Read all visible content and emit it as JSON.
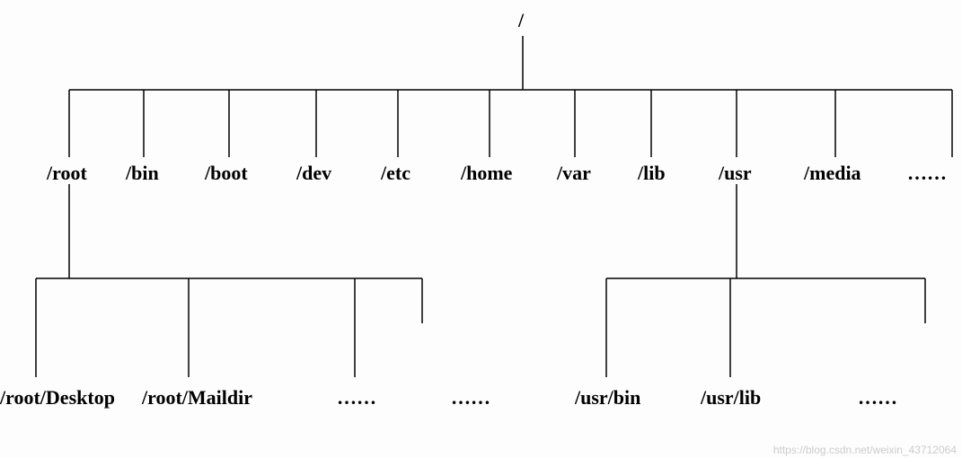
{
  "root": "/",
  "level1": {
    "root": "/root",
    "bin": "/bin",
    "boot": "/boot",
    "dev": "/dev",
    "etc": "/etc",
    "home": "/home",
    "var": "/var",
    "lib": "/lib",
    "usr": "/usr",
    "media": "/media",
    "more": "……"
  },
  "level2_root": {
    "desktop": "/root/Desktop",
    "maildir": "/root/Maildir",
    "more1": "……",
    "more2": "……"
  },
  "level2_usr": {
    "bin": "/usr/bin",
    "lib": "/usr/lib",
    "more": "……"
  },
  "watermark": "https://blog.csdn.net/weixin_43712064"
}
